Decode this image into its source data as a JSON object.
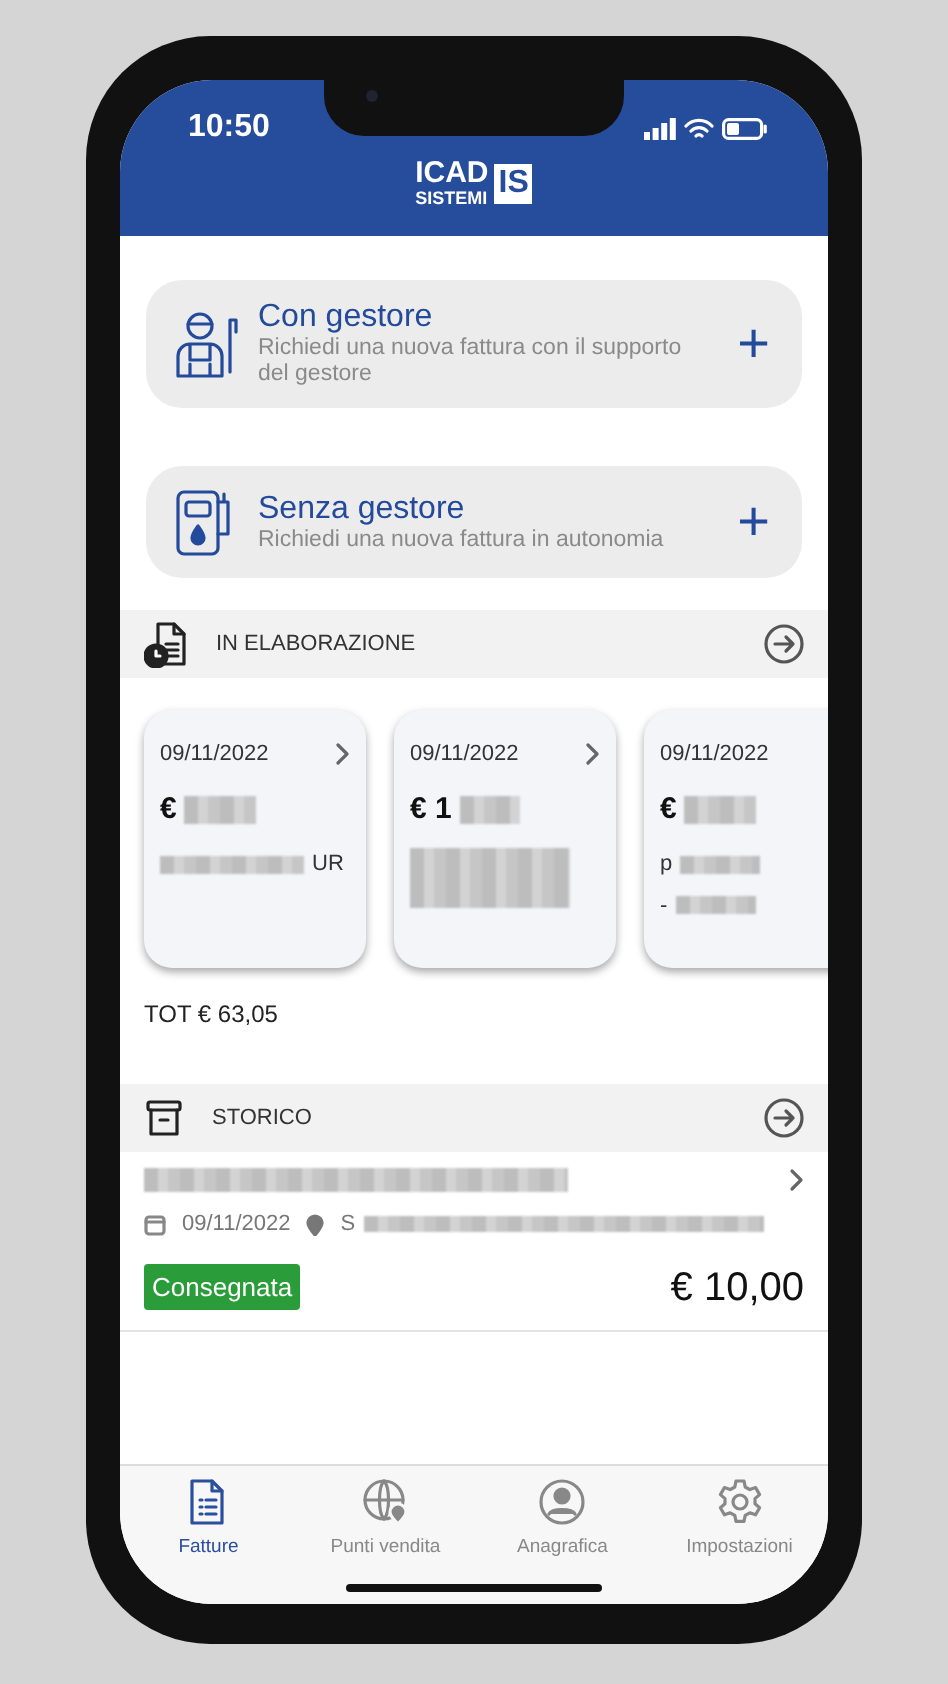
{
  "status_bar": {
    "time": "10:50"
  },
  "header": {
    "logo_top": "ICAD",
    "logo_bottom": "SISTEMI",
    "logo_mark": "IS"
  },
  "actions": [
    {
      "kind": "attendant",
      "title": "Con gestore",
      "subtitle": "Richiedi una nuova fattura con il supporto del gestore",
      "button": "+"
    },
    {
      "kind": "pump",
      "title": "Senza gestore",
      "subtitle": "Richiedi una nuova fattura in autonomia",
      "button": "+"
    }
  ],
  "processing": {
    "title": "IN ELABORAZIONE",
    "cards": [
      {
        "date": "09/11/2022",
        "amount": "€",
        "chevron": true,
        "lines": [
          {
            "text": "UR",
            "kind": "tail"
          }
        ]
      },
      {
        "date": "09/11/2022",
        "amount": "€ 1",
        "chevron": true
      },
      {
        "date": "09/11/2022",
        "amount": "€",
        "chevron": false,
        "lines": [
          {
            "text": "p",
            "kind": "head"
          },
          {
            "text": "-",
            "kind": "head"
          }
        ]
      }
    ],
    "total": "TOT € 63,05"
  },
  "history": {
    "title": "STORICO",
    "items": [
      {
        "date": "09/11/2022",
        "place": "S",
        "status": "Consegnata",
        "color": "#2a9d3a",
        "amount": "€ 10,00"
      }
    ]
  },
  "tabs": [
    {
      "kind": "invoices",
      "label": "Fatture",
      "selected": true
    },
    {
      "kind": "stores",
      "label": "Punti vendita",
      "selected": false
    },
    {
      "kind": "profile",
      "label": "Anagrafica",
      "selected": false
    },
    {
      "kind": "settings",
      "label": "Impostazioni",
      "selected": false
    }
  ]
}
